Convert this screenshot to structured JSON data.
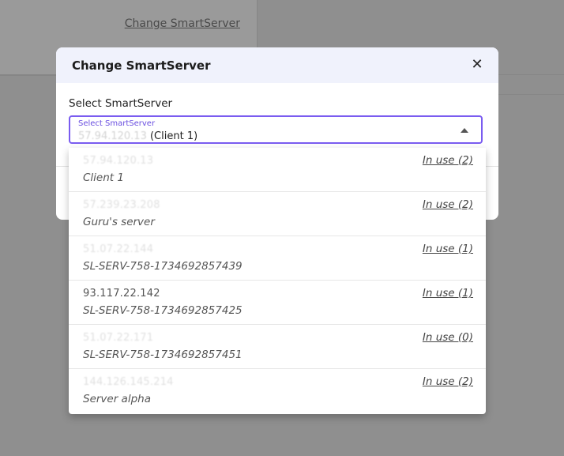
{
  "background": {
    "link_label": "Change SmartServer"
  },
  "modal": {
    "title": "Change SmartServer",
    "close_icon": "close-icon",
    "field_label": "Select SmartServer",
    "select": {
      "floating_label": "Select SmartServer",
      "value_ip": "57.94.120.13",
      "value_client": "(Client 1)",
      "caret_icon": "caret-up-icon"
    }
  },
  "dropdown": {
    "options": [
      {
        "ip": "57.94.120.13",
        "name": "Client 1",
        "usage": "In use (2)"
      },
      {
        "ip": "57.239.23.208",
        "name": "Guru's server",
        "usage": "In use (2)"
      },
      {
        "ip": "51.07.22.144",
        "name": "SL-SERV-758-1734692857439",
        "usage": "In use (1)"
      },
      {
        "ip": "93.117.22.142",
        "name": "SL-SERV-758-1734692857425",
        "usage": "In use (1)"
      },
      {
        "ip": "51.07.22.171",
        "name": "SL-SERV-758-1734692857451",
        "usage": "In use (0)"
      },
      {
        "ip": "144.126.145.214",
        "name": "Server alpha",
        "usage": "In use (2)"
      }
    ]
  }
}
